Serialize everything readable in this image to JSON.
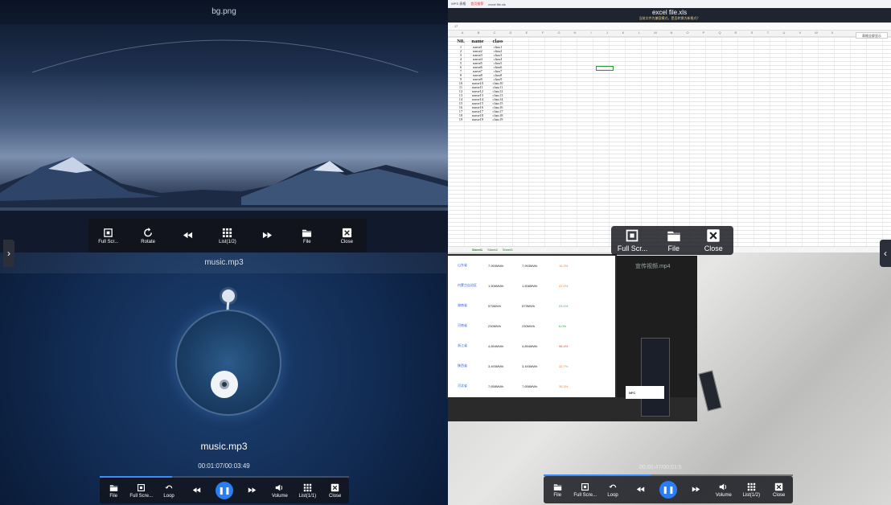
{
  "image_viewer": {
    "title": "bg.png",
    "toolbar": [
      {
        "label": "Full Scr...",
        "icon": "fullscreen-icon"
      },
      {
        "label": "Rotate",
        "icon": "rotate-icon"
      },
      {
        "label": "",
        "icon": "previous-icon"
      },
      {
        "label": "List(1/2)",
        "icon": "grid-list-icon"
      },
      {
        "label": "",
        "icon": "next-icon"
      },
      {
        "label": "File",
        "icon": "folder-icon"
      },
      {
        "label": "Close",
        "icon": "close-icon"
      }
    ]
  },
  "excel": {
    "browser_tabs": [
      "WPS 表格",
      "首页推荐",
      "excel file.xls"
    ],
    "title": "excel file.xls",
    "notice": "当前文件为兼容模式，是否转换为新格式？",
    "cell_ref": "J7",
    "col_letters": [
      "A",
      "B",
      "C",
      "D",
      "E",
      "F",
      "G",
      "H",
      "I",
      "J",
      "K",
      "L",
      "M",
      "N",
      "O",
      "P",
      "Q",
      "R",
      "S",
      "T",
      "U",
      "V",
      "W",
      "X"
    ],
    "headers": [
      "N0.",
      "name",
      "class"
    ],
    "rows": [
      [
        "1",
        "name1",
        "class1"
      ],
      [
        "2",
        "name2",
        "class2"
      ],
      [
        "3",
        "name3",
        "class3"
      ],
      [
        "4",
        "name4",
        "class4"
      ],
      [
        "5",
        "name5",
        "class5"
      ],
      [
        "6",
        "name6",
        "class6"
      ],
      [
        "7",
        "name7",
        "class7"
      ],
      [
        "8",
        "name8",
        "class8"
      ],
      [
        "9",
        "name9",
        "class9"
      ],
      [
        "10",
        "name10",
        "class10"
      ],
      [
        "11",
        "name11",
        "class11"
      ],
      [
        "12",
        "name12",
        "class12"
      ],
      [
        "13",
        "name13",
        "class13"
      ],
      [
        "14",
        "name14",
        "class14"
      ],
      [
        "15",
        "name15",
        "class15"
      ],
      [
        "16",
        "name16",
        "class16"
      ],
      [
        "17",
        "name17",
        "class17"
      ],
      [
        "18",
        "name18",
        "class18"
      ],
      [
        "19",
        "name19",
        "class19"
      ]
    ],
    "sheet_tabs": [
      "Sheet1",
      "Sheet2",
      "Sheet3"
    ],
    "side_label": "表格全屏显示",
    "toolbar": [
      {
        "label": "Full Scr...",
        "icon": "fullscreen-icon"
      },
      {
        "label": "File",
        "icon": "folder-icon"
      },
      {
        "label": "Close",
        "icon": "close-icon"
      }
    ]
  },
  "music": {
    "title": "music.mp3",
    "song_name": "music.mp3",
    "time": "00:01:07/00:03:49",
    "progress": 0.29,
    "toolbar": [
      {
        "label": "File",
        "icon": "folder-icon"
      },
      {
        "label": "Full Scre...",
        "icon": "fullscreen-icon"
      },
      {
        "label": "Loop",
        "icon": "loop-icon"
      },
      {
        "label": "",
        "icon": "previous-icon"
      },
      {
        "label": "",
        "icon": "pause-icon"
      },
      {
        "label": "",
        "icon": "next-icon"
      },
      {
        "label": "Volume",
        "icon": "volume-icon"
      },
      {
        "label": "List(1/1)",
        "icon": "grid-list-icon"
      },
      {
        "label": "Close",
        "icon": "close-icon"
      }
    ]
  },
  "video": {
    "title": "宣传视频.mp4",
    "time": "00:00:47/00:01:5",
    "progress": 0.43,
    "slide_rows": [
      {
        "province": "山东省",
        "v1": "7,993MWh",
        "v2": "7,993MWh",
        "pct": "15.3%",
        "pct_color": "#f07d2a"
      },
      {
        "province": "内蒙古自治区",
        "v1": "1,506MWh",
        "v2": "1,506MWh",
        "pct": "47.0%",
        "pct_color": "#f07d2a"
      },
      {
        "province": "湖南省",
        "v1": "575MWh",
        "v2": "575MWh",
        "pct": "23.1%",
        "pct_color": "#2aa84a"
      },
      {
        "province": "河南省",
        "v1": "230MWh",
        "v2": "230MWh",
        "pct": "6.0%",
        "pct_color": "#2aa84a"
      },
      {
        "province": "浙江省",
        "v1": "4,894MWh",
        "v2": "4,894MWh",
        "pct": "98.4%",
        "pct_color": "#e23b3b"
      },
      {
        "province": "陕西省",
        "v1": "3,493MWh",
        "v2": "3,493MWh",
        "pct": "32.7%",
        "pct_color": "#f07d2a"
      },
      {
        "province": "河北省",
        "v1": "7,658MWh",
        "v2": "7,658MWh",
        "pct": "35.3%",
        "pct_color": "#f07d2a"
      }
    ],
    "nfc_label": "NFC",
    "toolbar": [
      {
        "label": "File",
        "icon": "folder-icon"
      },
      {
        "label": "Full Scre...",
        "icon": "fullscreen-icon"
      },
      {
        "label": "Loop",
        "icon": "loop-icon"
      },
      {
        "label": "",
        "icon": "previous-icon"
      },
      {
        "label": "",
        "icon": "pause-icon"
      },
      {
        "label": "",
        "icon": "next-icon"
      },
      {
        "label": "Volume",
        "icon": "volume-icon"
      },
      {
        "label": "List(1/2)",
        "icon": "grid-list-icon"
      },
      {
        "label": "Close",
        "icon": "close-icon"
      }
    ]
  },
  "side_tabs": {
    "left": "›",
    "right": "‹"
  },
  "colors": {
    "accent": "#2a7df3",
    "toolbar_bg": "#14161c"
  }
}
